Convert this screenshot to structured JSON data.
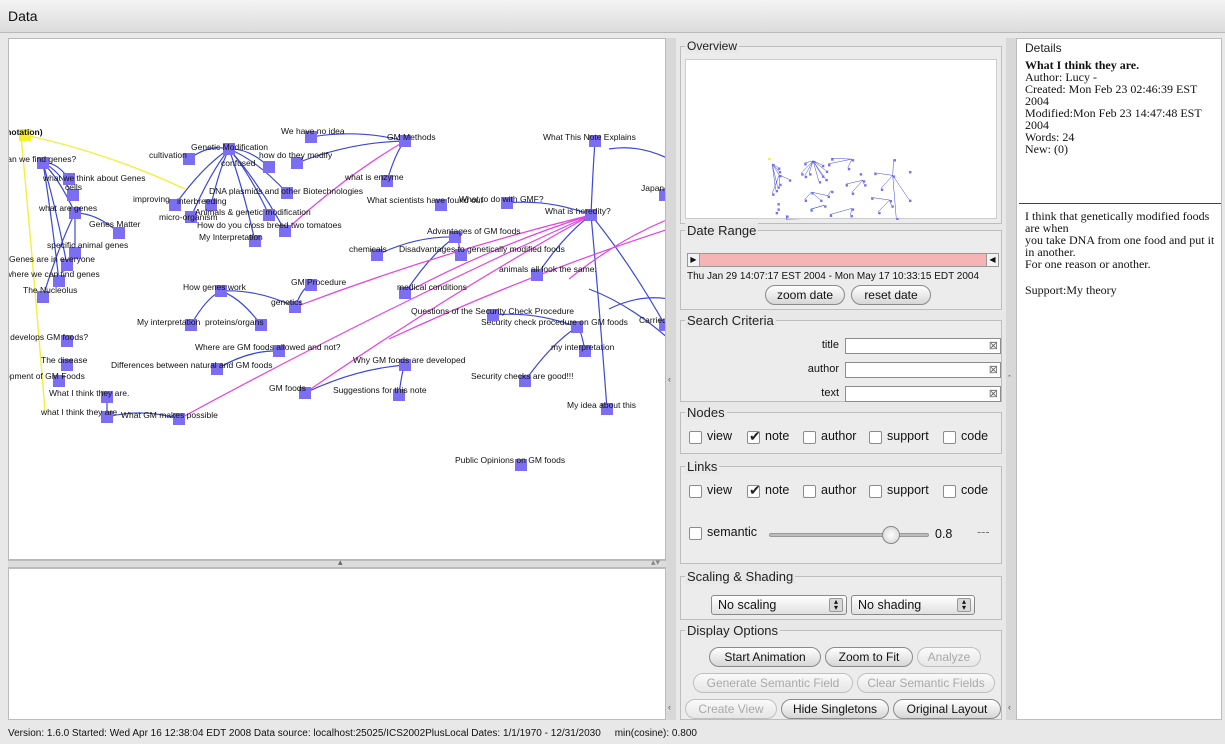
{
  "window": {
    "title": "Data"
  },
  "colors": {
    "node": "#7b6ef2",
    "highlight_node": "#f4f02a",
    "link_blue": "#3b47d8",
    "link_magenta": "#e83de8",
    "link_yellow": "#f2ef40",
    "date_range_bar": "#f5b5b5"
  },
  "graph": {
    "labels": [
      "nnotation)",
      "can we find genes?",
      "what we think about Genes",
      "cells",
      "what are genes",
      "Genes Matter",
      "specific animal genes",
      "Genes are in everyone",
      "f where we can find genes",
      "The Nucleolus",
      "cultivation",
      "Genetic Modification",
      "confused",
      "improving",
      "interbreeding",
      "DNA plasmids and other Biotechnologies",
      "micro-organism",
      "Animals & genetic modification",
      "How do you cross breed two tomatoes",
      "My Interpretation",
      "We have no idea",
      "how do they modify",
      "GM Methods",
      "what is enzyme",
      "What This Note Explains",
      "What scientists have found out",
      "What to do with GMF?",
      "Japane",
      "What is heredity?",
      "Advantages of GM foods",
      "chemicals",
      "Disadvantages to genetically modified foods",
      "animals all look the same.",
      "medical conditions",
      "How genes work",
      "GM Procedure",
      "genetics",
      "My interpretation",
      "proteins/organs",
      "Security check procedure on GM foods",
      "Questions of the Security Check Procedure",
      "Carried",
      "o develops GM foods?",
      "Where are GM foods allowed and not?",
      "my interpretation",
      "The disease",
      "opment of GM Foods",
      "Differences between natural and GM foods",
      "Why GM foods are developed",
      "Security checks are good!!!",
      "What I think they are.",
      "GM foods",
      "Suggestions for this note",
      "My idea about this",
      "what I think they are",
      "What GM makes possible",
      "Public Opinions on GM foods"
    ]
  },
  "overview": {
    "label": "Overview"
  },
  "date_range": {
    "label": "Date Range",
    "text": "Thu Jan 29 14:07:17 EST 2004 - Mon May 17 10:33:15 EDT 2004",
    "zoom_button": "zoom date",
    "reset_button": "reset date"
  },
  "search": {
    "label": "Search Criteria",
    "fields": [
      "title",
      "author",
      "text"
    ]
  },
  "nodes": {
    "label": "Nodes",
    "options": [
      {
        "label": "view",
        "checked": false
      },
      {
        "label": "note",
        "checked": true
      },
      {
        "label": "author",
        "checked": false
      },
      {
        "label": "support",
        "checked": false
      },
      {
        "label": "code",
        "checked": false
      }
    ]
  },
  "links": {
    "label": "Links",
    "options": [
      {
        "label": "view",
        "checked": false
      },
      {
        "label": "note",
        "checked": true
      },
      {
        "label": "author",
        "checked": false
      },
      {
        "label": "support",
        "checked": false
      },
      {
        "label": "code",
        "checked": false
      }
    ],
    "semantic_label": "semantic",
    "semantic_checked": false,
    "semantic_value": "0.8",
    "semantic_level": 0.8,
    "dashes": "---"
  },
  "scaling": {
    "label": "Scaling & Shading",
    "scaling_value": "No scaling",
    "shading_value": "No shading"
  },
  "display": {
    "label": "Display Options",
    "start_animation": "Start Animation",
    "zoom_to_fit": "Zoom to Fit",
    "analyze": "Analyze",
    "generate_semantic": "Generate Semantic Field",
    "clear_semantic": "Clear Semantic Fields",
    "create_view": "Create View",
    "hide_singletons": "Hide Singletons",
    "original_layout": "Original Layout"
  },
  "details": {
    "label": "Details",
    "title": "What I think they are.",
    "author": "Author: Lucy -",
    "created": "Created: Mon Feb 23 02:46:39 EST 2004",
    "modified": "Modified:Mon Feb 23 14:47:48 EST 2004",
    "words": "Words: 24",
    "new": "New: (0)",
    "body_line1": "I think that genetically modified foods are when",
    "body_line2": "you take DNA from one food and put it in another.",
    "body_line3": "For one reason or another.",
    "support": "Support:My theory"
  },
  "status": {
    "text": "Version: 1.6.0 Started: Wed Apr 16 12:38:04 EDT 2008 Data source: localhost:25025/ICS2002PlusLocal Dates: 1/1/1970 - 12/31/2030     min(cosine): 0.800"
  }
}
